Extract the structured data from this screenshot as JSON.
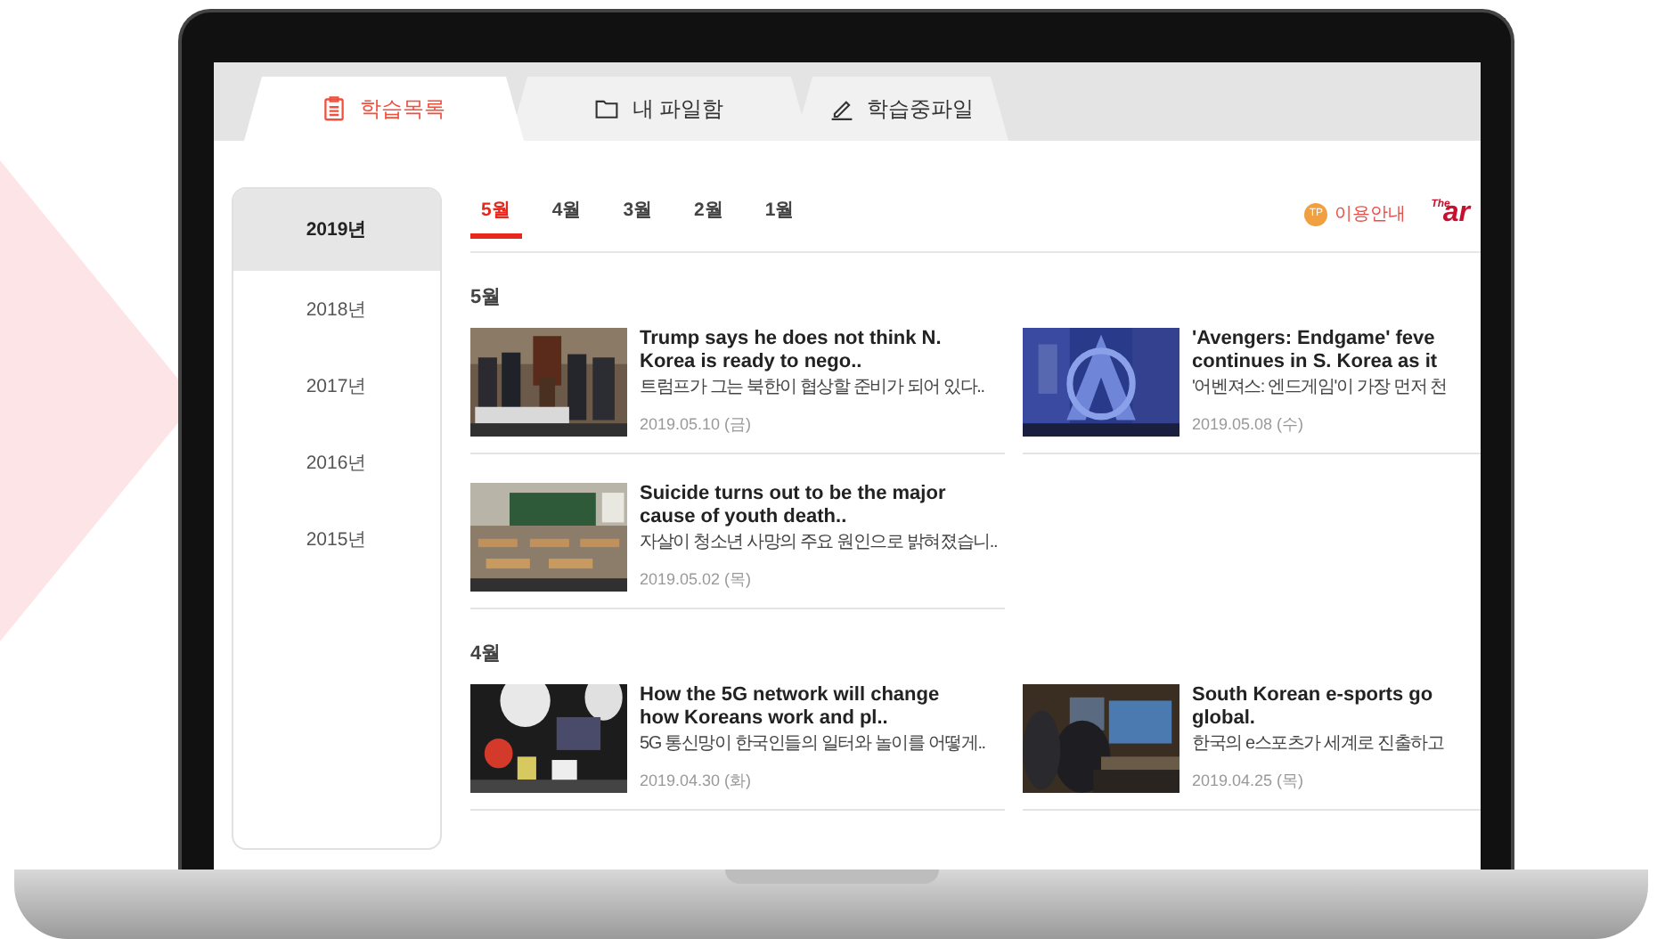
{
  "tabs": [
    {
      "label": "학습목록",
      "kind": "list",
      "selected": true
    },
    {
      "label": "내 파일함",
      "kind": "folder",
      "selected": false
    },
    {
      "label": "학습중파일",
      "kind": "pencil",
      "selected": false
    }
  ],
  "years": [
    {
      "label": "2019년",
      "selected": true
    },
    {
      "label": "2018년",
      "selected": false
    },
    {
      "label": "2017년",
      "selected": false
    },
    {
      "label": "2016년",
      "selected": false
    },
    {
      "label": "2015년",
      "selected": false
    }
  ],
  "months": [
    {
      "label": "5월",
      "selected": true
    },
    {
      "label": "4월",
      "selected": false
    },
    {
      "label": "3월",
      "selected": false
    },
    {
      "label": "2월",
      "selected": false
    },
    {
      "label": "1월",
      "selected": false
    }
  ],
  "guide": {
    "badge": "TP",
    "label": "이용안내"
  },
  "logo": {
    "small": "The",
    "text": "ar"
  },
  "sections": [
    {
      "heading": "5월",
      "cards": [
        {
          "title_lines": [
            "Trump says he does not think N.",
            "Korea is ready to nego.."
          ],
          "summary": "트럼프가 그는 북한이 협상할 준비가 되어 있다..",
          "date": "2019.05.10 (금)"
        },
        {
          "title_lines": [
            "'Avengers: Endgame' feve",
            "continues in S. Korea as it"
          ],
          "summary": "'어벤져스: 엔드게임'이 가장 먼저 천",
          "date": "2019.05.08 (수)"
        },
        {
          "title_lines": [
            "Suicide turns out to be the major",
            "cause of youth death.."
          ],
          "summary": "자살이 청소년 사망의 주요 원인으로 밝혀졌습니..",
          "date": "2019.05.02 (목)"
        }
      ]
    },
    {
      "heading": "4월",
      "cards": [
        {
          "title_lines": [
            "How the 5G network will change",
            "how Koreans work and pl.."
          ],
          "summary": "5G 통신망이 한국인들의 일터와 놀이를 어떻게..",
          "date": "2019.04.30 (화)"
        },
        {
          "title_lines": [
            "South Korean e-sports go",
            "global."
          ],
          "summary": "한국의 e스포츠가 세계로 진출하고",
          "date": "2019.04.25 (목)"
        }
      ]
    }
  ]
}
